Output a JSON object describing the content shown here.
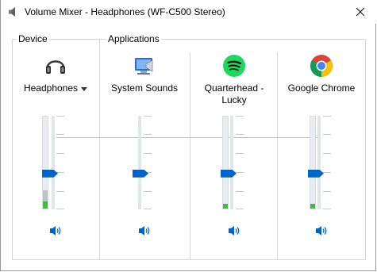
{
  "window": {
    "title": "Volume Mixer - Headphones (WF-C500 Stereo)"
  },
  "sections": {
    "device_label": "Device",
    "applications_label": "Applications"
  },
  "device": {
    "name": "Headphones",
    "icon": "headphones-icon",
    "volume_level": 0.4,
    "meter_peak": 0.08,
    "meter_recent": 0.2,
    "mute_icon": "speaker-icon"
  },
  "applications": [
    {
      "name": "System Sounds",
      "icon": "system-sounds-icon",
      "volume_level": 0.4,
      "meter_peak": 0.0,
      "mute_icon": "speaker-icon"
    },
    {
      "name": "Quarterhead - Lucky",
      "icon": "spotify-icon",
      "volume_level": 0.4,
      "meter_peak": 0.05,
      "mute_icon": "speaker-icon"
    },
    {
      "name": "Google Chrome",
      "icon": "chrome-icon",
      "volume_level": 0.4,
      "meter_peak": 0.05,
      "mute_icon": "speaker-icon"
    }
  ],
  "colors": {
    "accent": "#0063c6",
    "meter_green": "#49b649",
    "spotify": "#1ed760"
  }
}
